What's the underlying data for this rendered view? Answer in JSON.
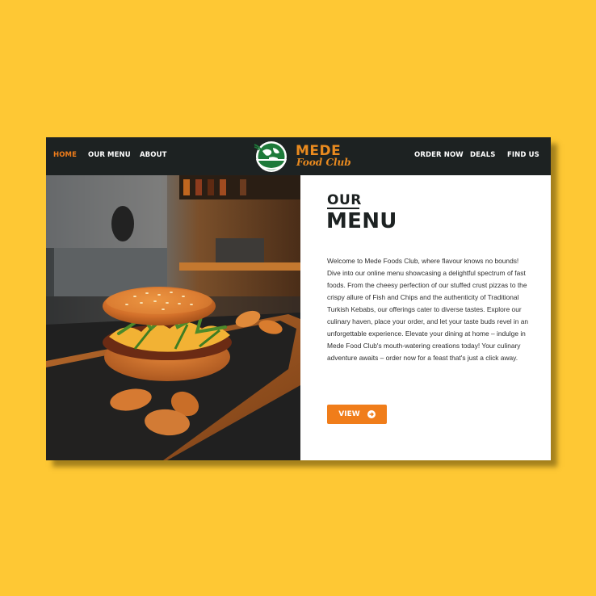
{
  "nav": {
    "left": [
      {
        "label": "HOME",
        "active": true
      },
      {
        "label": "OUR MENU",
        "active": false
      },
      {
        "label": "ABOUT",
        "active": false
      }
    ],
    "right": [
      {
        "label": "ORDER NOW"
      },
      {
        "label": "DEALS"
      },
      {
        "label": "FIND US"
      }
    ]
  },
  "logo": {
    "title": "MEDE",
    "subtitle": "Food Club",
    "icon": "globe-bowl-icon"
  },
  "main": {
    "heading_small": "OUR",
    "heading_large": "MENU",
    "body": "Welcome to Mede Foods Club, where flavour knows no bounds! Dive into our online menu showcasing a delightful spectrum of fast foods. From the cheesy perfection of our stuffed crust pizzas to the crispy allure of Fish and Chips and the authenticity of Traditional Turkish Kebabs, our offerings cater to diverse tastes. Explore our culinary haven, place your order, and let your taste buds revel in an unforgettable experience. Elevate your dining at home – indulge in Mede Food Club's mouth-watering creations today! Your culinary adventure awaits – order now for a feast that's just a click away.",
    "button_label": "VIEW"
  },
  "colors": {
    "background": "#fec834",
    "nav_bg": "#1d2222",
    "accent": "#f07d1a",
    "logo_green": "#1e7a3a"
  }
}
